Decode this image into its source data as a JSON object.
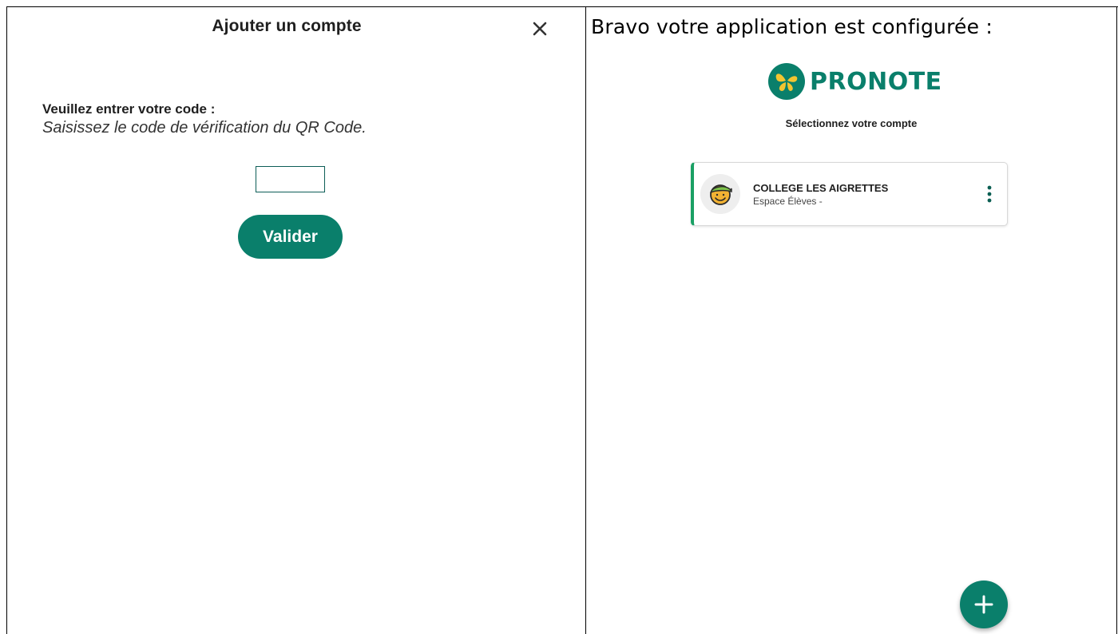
{
  "left": {
    "title": "Ajouter un compte",
    "close_icon": "close-icon",
    "prompt": "Veuillez entrer votre code :",
    "hint": "Saisissez le code de vérification du QR Code.",
    "code_input": {
      "value": "",
      "placeholder": ""
    },
    "validate_label": "Valider"
  },
  "right": {
    "heading": "Bravo votre application est configurée :",
    "logo_text": "PRONOTE",
    "select_label": "Sélectionnez votre compte",
    "account": {
      "school": "COLLEGE LES AIGRETTES",
      "space": "Espace Élèves -",
      "avatar_icon": "student-avatar-icon",
      "menu_icon": "more-vertical-icon"
    },
    "add_icon": "plus-icon"
  },
  "colors": {
    "brand_green": "#0a7f6b",
    "card_accent": "#1aa064",
    "input_border": "#0d5e57"
  }
}
